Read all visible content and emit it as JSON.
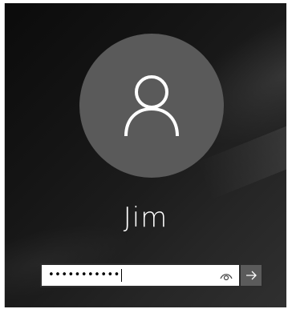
{
  "user": {
    "display_name": "Jim",
    "avatar_icon": "user-silhouette-icon"
  },
  "password_field": {
    "value": "•••••••••••",
    "reveal_icon": "eye-icon",
    "submit_icon": "arrow-right-icon"
  },
  "colors": {
    "avatar_bg": "#5a5a5a",
    "submit_bg": "#5b5b5b",
    "text": "#ffffff"
  }
}
